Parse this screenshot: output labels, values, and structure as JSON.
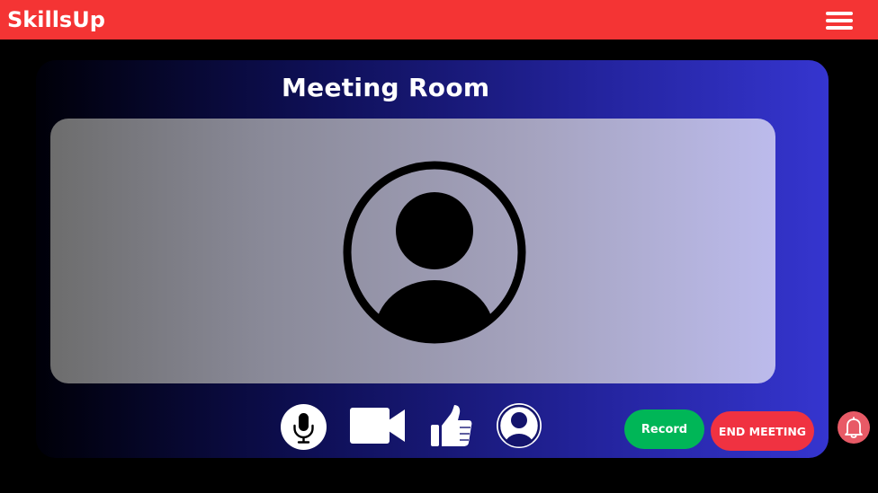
{
  "header": {
    "brand": "SkillsUp",
    "menu_icon": "hamburger-menu-icon"
  },
  "meeting": {
    "title": "Meeting Room",
    "participant_icon": "user-avatar-icon"
  },
  "controls": {
    "mic_icon": "microphone-icon",
    "camera_icon": "video-camera-icon",
    "like_icon": "thumbs-up-icon",
    "profile_icon": "user-profile-icon",
    "record_label": "Record",
    "end_label": "END MEETING",
    "bell_icon": "bell-icon"
  },
  "colors": {
    "topbar": "#f43434",
    "record": "#00b657",
    "end_meeting": "#f03241",
    "panel_accent": "#3535cf"
  }
}
